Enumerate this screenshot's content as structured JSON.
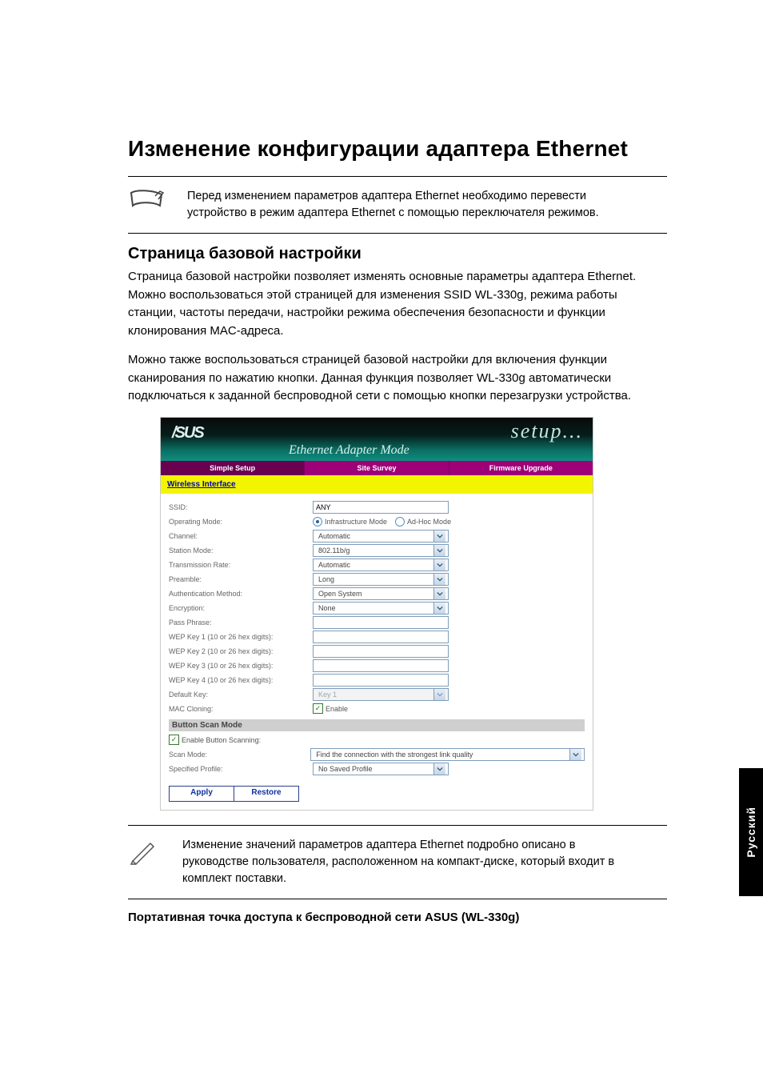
{
  "title": "Изменение конфигурации адаптера Ethernet",
  "note1": "Перед изменением параметров адаптера Ethernet необходимо перевести устройство в режим адаптера Ethernet с помощью переключателя режимов.",
  "subheading": "Страница базовой настройки",
  "para1": "Страница базовой настройки позволяет изменять основные параметры адаптера Ethernet. Можно воспользоваться этой страницей для изменения SSID WL-330g, режима работы станции, частоты передачи, настройки режима обеспечения безопасности и функции клонирования MAC-адреса.",
  "para2": "Можно также воспользоваться страницей базовой настройки для включения функции сканирования по нажатию кнопки. Данная функция позволяет WL-330g автоматически подключаться к заданной беспроводной сети с помощью кнопки перезагрузки устройства.",
  "note2": "Изменение значений параметров адаптера Ethernet подробно описано в руководстве пользователя, расположенном на компакт-диске, который входит в комплект поставки.",
  "footer": "Портативная точка доступа к беспроводной сети ASUS (WL-330g)",
  "side_tab": "Русский",
  "ui": {
    "brand": "/SUS",
    "mode_title": "Ethernet Adapter Mode",
    "setup_text": "setup...",
    "tabs": {
      "simple": "Simple Setup",
      "survey": "Site Survey",
      "firmware": "Firmware Upgrade"
    },
    "section_wireless": "Wireless Interface",
    "labels": {
      "ssid": "SSID:",
      "op_mode": "Operating Mode:",
      "channel": "Channel:",
      "station": "Station Mode:",
      "tx": "Transmission Rate:",
      "preamble": "Preamble:",
      "auth": "Authentication Method:",
      "enc": "Encryption:",
      "pass": "Pass Phrase:",
      "wep1": "WEP Key 1 (10 or 26 hex digits):",
      "wep2": "WEP Key 2 (10 or 26 hex digits):",
      "wep3": "WEP Key 3 (10 or 26 hex digits):",
      "wep4": "WEP Key 4 (10 or 26 hex digits):",
      "defkey": "Default Key:",
      "mac": "MAC Cloning:",
      "scan_section": "Button Scan Mode",
      "en_scan": "Enable Button Scanning:",
      "scan_mode": "Scan Mode:",
      "profile": "Specified Profile:"
    },
    "values": {
      "ssid": "ANY",
      "radio_infra": "Infrastructure Mode",
      "radio_adhoc": "Ad-Hoc Mode",
      "channel": "Automatic",
      "station": "802.11b/g",
      "tx": "Automatic",
      "preamble": "Long",
      "auth": "Open System",
      "enc": "None",
      "defkey": "Key 1",
      "mac_enable": "Enable",
      "scan_mode": "Find the connection with the strongest link quality",
      "profile": "No Saved Profile"
    },
    "buttons": {
      "apply": "Apply",
      "restore": "Restore"
    }
  }
}
